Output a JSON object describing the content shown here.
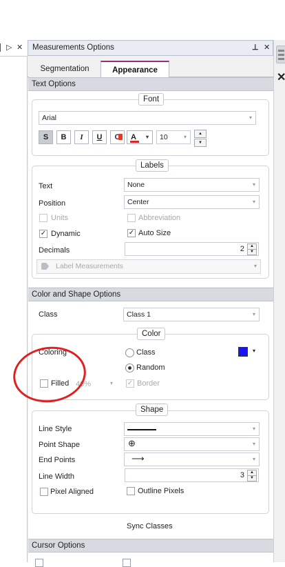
{
  "left_toolbar": {
    "icons": [
      "tab-left-arrow",
      "tab-right-arrow",
      "close"
    ],
    "glyphs": [
      "▷",
      "▷",
      "✕"
    ]
  },
  "right_strip": {
    "icons": [
      "layers-icon",
      "close-icon"
    ],
    "close_glyph": "✕"
  },
  "panel": {
    "title": "Measurements Options",
    "pin_glyph": "⊥",
    "close_glyph": "✕",
    "tabs": [
      {
        "label": "Segmentation",
        "active": false
      },
      {
        "label": "Appearance",
        "active": true
      }
    ]
  },
  "text_options": {
    "header": "Text Options",
    "font": {
      "group_title": "Font",
      "family": "Arial",
      "buttons": {
        "shadow": "S",
        "bold": "B",
        "italic": "I",
        "underline": "U",
        "color_fill": "C",
        "font_color": "A"
      },
      "font_color_hex": "#d9262b",
      "size": "10"
    },
    "labels": {
      "group_title": "Labels",
      "text_label": "Text",
      "text_value": "None",
      "position_label": "Position",
      "position_value": "Center",
      "units_label": "Units",
      "abbreviation_label": "Abbreviation",
      "dynamic_label": "Dynamic",
      "dynamic_checked": true,
      "autosize_label": "Auto Size",
      "autosize_checked": true,
      "decimals_label": "Decimals",
      "decimals_value": "2",
      "measurement_placeholder": "Label Measurements"
    }
  },
  "color_shape": {
    "header": "Color and Shape Options",
    "class_label": "Class",
    "class_value": "Class 1",
    "color": {
      "group_title": "Color",
      "coloring_label": "Coloring",
      "class_radio": "Class",
      "random_radio": "Random",
      "selected": "Random",
      "swatch_hex": "#1a14f5",
      "filled_label": "Filled",
      "filled_checked": false,
      "opacity_value": "40%",
      "border_label": "Border",
      "border_checked": true
    },
    "shape": {
      "group_title": "Shape",
      "line_style_label": "Line Style",
      "point_shape_label": "Point Shape",
      "end_points_label": "End Points",
      "line_width_label": "Line  Width",
      "line_width_value": "3",
      "pixel_aligned_label": "Pixel Aligned",
      "outline_pixels_label": "Outline Pixels"
    },
    "sync_label": "Sync Classes"
  },
  "cursor_options": {
    "header": "Cursor Options"
  }
}
